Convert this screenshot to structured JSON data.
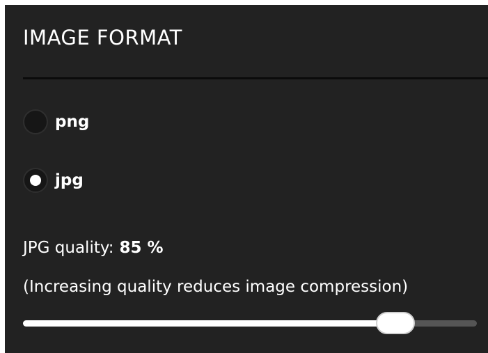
{
  "panel": {
    "title": "IMAGE FORMAT"
  },
  "format_options": [
    {
      "label": "png",
      "selected": false
    },
    {
      "label": "jpg",
      "selected": true
    }
  ],
  "jpg_quality": {
    "label": "JPG quality:",
    "value_text": "85 %",
    "value": 85,
    "min": 0,
    "max": 100
  },
  "hint": "(Increasing quality reduces image compression)",
  "colors": {
    "panel_background": "#222222",
    "text": "#ffffff",
    "slider_fill": "#ffffff",
    "slider_track": "#555555"
  },
  "icons": {
    "radio_unselected": "radio-unselected-icon",
    "radio_selected": "radio-selected-icon"
  }
}
